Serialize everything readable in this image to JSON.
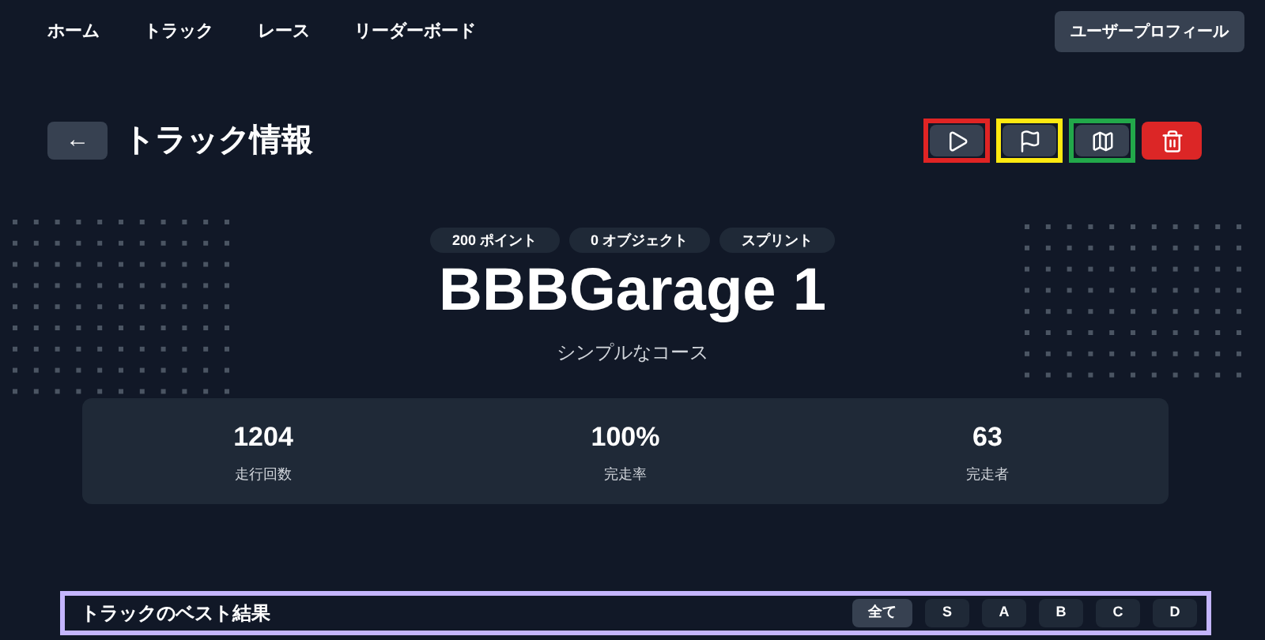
{
  "nav": {
    "links": [
      {
        "label": "ホーム"
      },
      {
        "label": "トラック"
      },
      {
        "label": "レース"
      },
      {
        "label": "リーダーボード"
      }
    ],
    "profile_button": "ユーザープロフィール"
  },
  "header": {
    "back_button": "←",
    "title": "トラック情報",
    "actions": [
      {
        "kind": "play",
        "color": "#e02424"
      },
      {
        "kind": "flag",
        "color": "#fde910"
      },
      {
        "kind": "map",
        "color": "#22a84a"
      },
      {
        "kind": "delete"
      }
    ]
  },
  "track": {
    "badges": [
      "200 ポイント",
      "0 オブジェクト",
      "スプリント"
    ],
    "name": "BBBGarage 1",
    "description": "シンプルなコース"
  },
  "stats": [
    {
      "value": "1204",
      "label": "走行回数"
    },
    {
      "value": "100%",
      "label": "完走率"
    },
    {
      "value": "63",
      "label": "完走者"
    }
  ],
  "best_results": {
    "title": "トラックのベスト結果",
    "color": "#c4b5fd",
    "filters": [
      {
        "label": "全て",
        "selected": true
      },
      {
        "label": "S",
        "selected": false
      },
      {
        "label": "A",
        "selected": false
      },
      {
        "label": "B",
        "selected": false
      },
      {
        "label": "C",
        "selected": false
      },
      {
        "label": "D",
        "selected": false
      }
    ]
  }
}
